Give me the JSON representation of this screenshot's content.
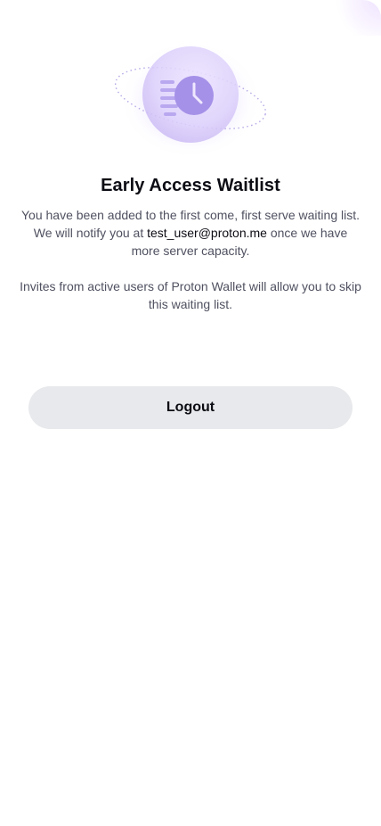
{
  "waitlist": {
    "title": "Early Access Waitlist",
    "message_before_email": "You have been added to the first come, first serve waiting list. We will notify you at ",
    "email": "test_user@proton.me",
    "message_after_email": " once we have more server capacity.",
    "invite_note": "Invites from active users of Proton Wallet will allow you to skip this waiting list.",
    "logout_label": "Logout",
    "illustration_icon": "clock-fast-icon"
  },
  "colors": {
    "accent": "#a691e8",
    "text_primary": "#0c0c14",
    "text_secondary": "#4f5160",
    "button_background": "#e8e9ec"
  }
}
